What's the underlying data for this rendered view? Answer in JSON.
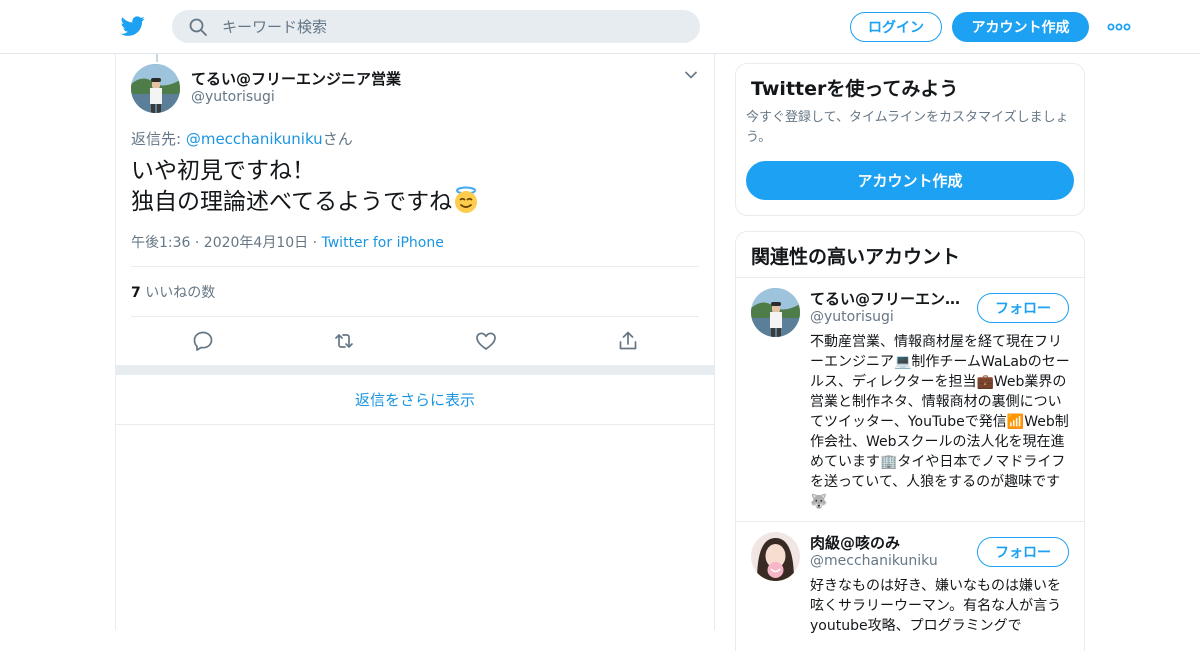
{
  "header": {
    "search_placeholder": "キーワード検索",
    "login_label": "ログイン",
    "signup_label": "アカウント作成",
    "logo_icon": "twitter-bird-icon",
    "more_icon": "more-dots-icon",
    "brand_color": "#1da1f2"
  },
  "tweet": {
    "author_name": "てるい@フリーエンジニア営業",
    "author_handle": "@yutorisugi",
    "reply_prefix": "返信先: ",
    "reply_to": "@mecchanikuniku",
    "reply_suffix": "さん",
    "text_line1": "いや初見ですね！",
    "text_line2": "独自の理論述べてるようですね",
    "text_emoji": "smiling-face-with-halo",
    "timestamp": "午後1:36 · 2020年4月10日 · ",
    "source": "Twitter for iPhone",
    "like_count": "7",
    "like_label": " いいねの数",
    "actions": [
      "reply-icon",
      "retweet-icon",
      "like-icon",
      "share-icon"
    ]
  },
  "show_more_replies": "返信をさらに表示",
  "signup_card": {
    "title": "Twitterを使ってみよう",
    "description": "今すぐ登録して、タイムラインをカスタマイズしましょう。",
    "button": "アカウント作成"
  },
  "related": {
    "title": "関連性の高いアカウント",
    "follow_label": "フォロー",
    "accounts": [
      {
        "name": "てるい@フリーエンジニア営業",
        "handle": "@yutorisugi",
        "bio": "不動産営業、情報商材屋を経て現在フリーエンジニア💻制作チームWaLabのセールス、ディレクターを担当💼Web業界の営業と制作ネタ、情報商材の裏側についてツイッター、YouTubeで発信📶Web制作会社、Webスクールの法人化を現在進めています🏢タイや日本でノマドライフを送っていて、人狼をするのが趣味です🐺"
      },
      {
        "name": "肉級@咳のみ",
        "handle": "@mecchanikuniku",
        "bio": "好きなものは好き、嫌いなものは嫌いを呟くサラリーウーマン。有名な人が言うyoutube攻略、プログラミングで"
      }
    ]
  }
}
